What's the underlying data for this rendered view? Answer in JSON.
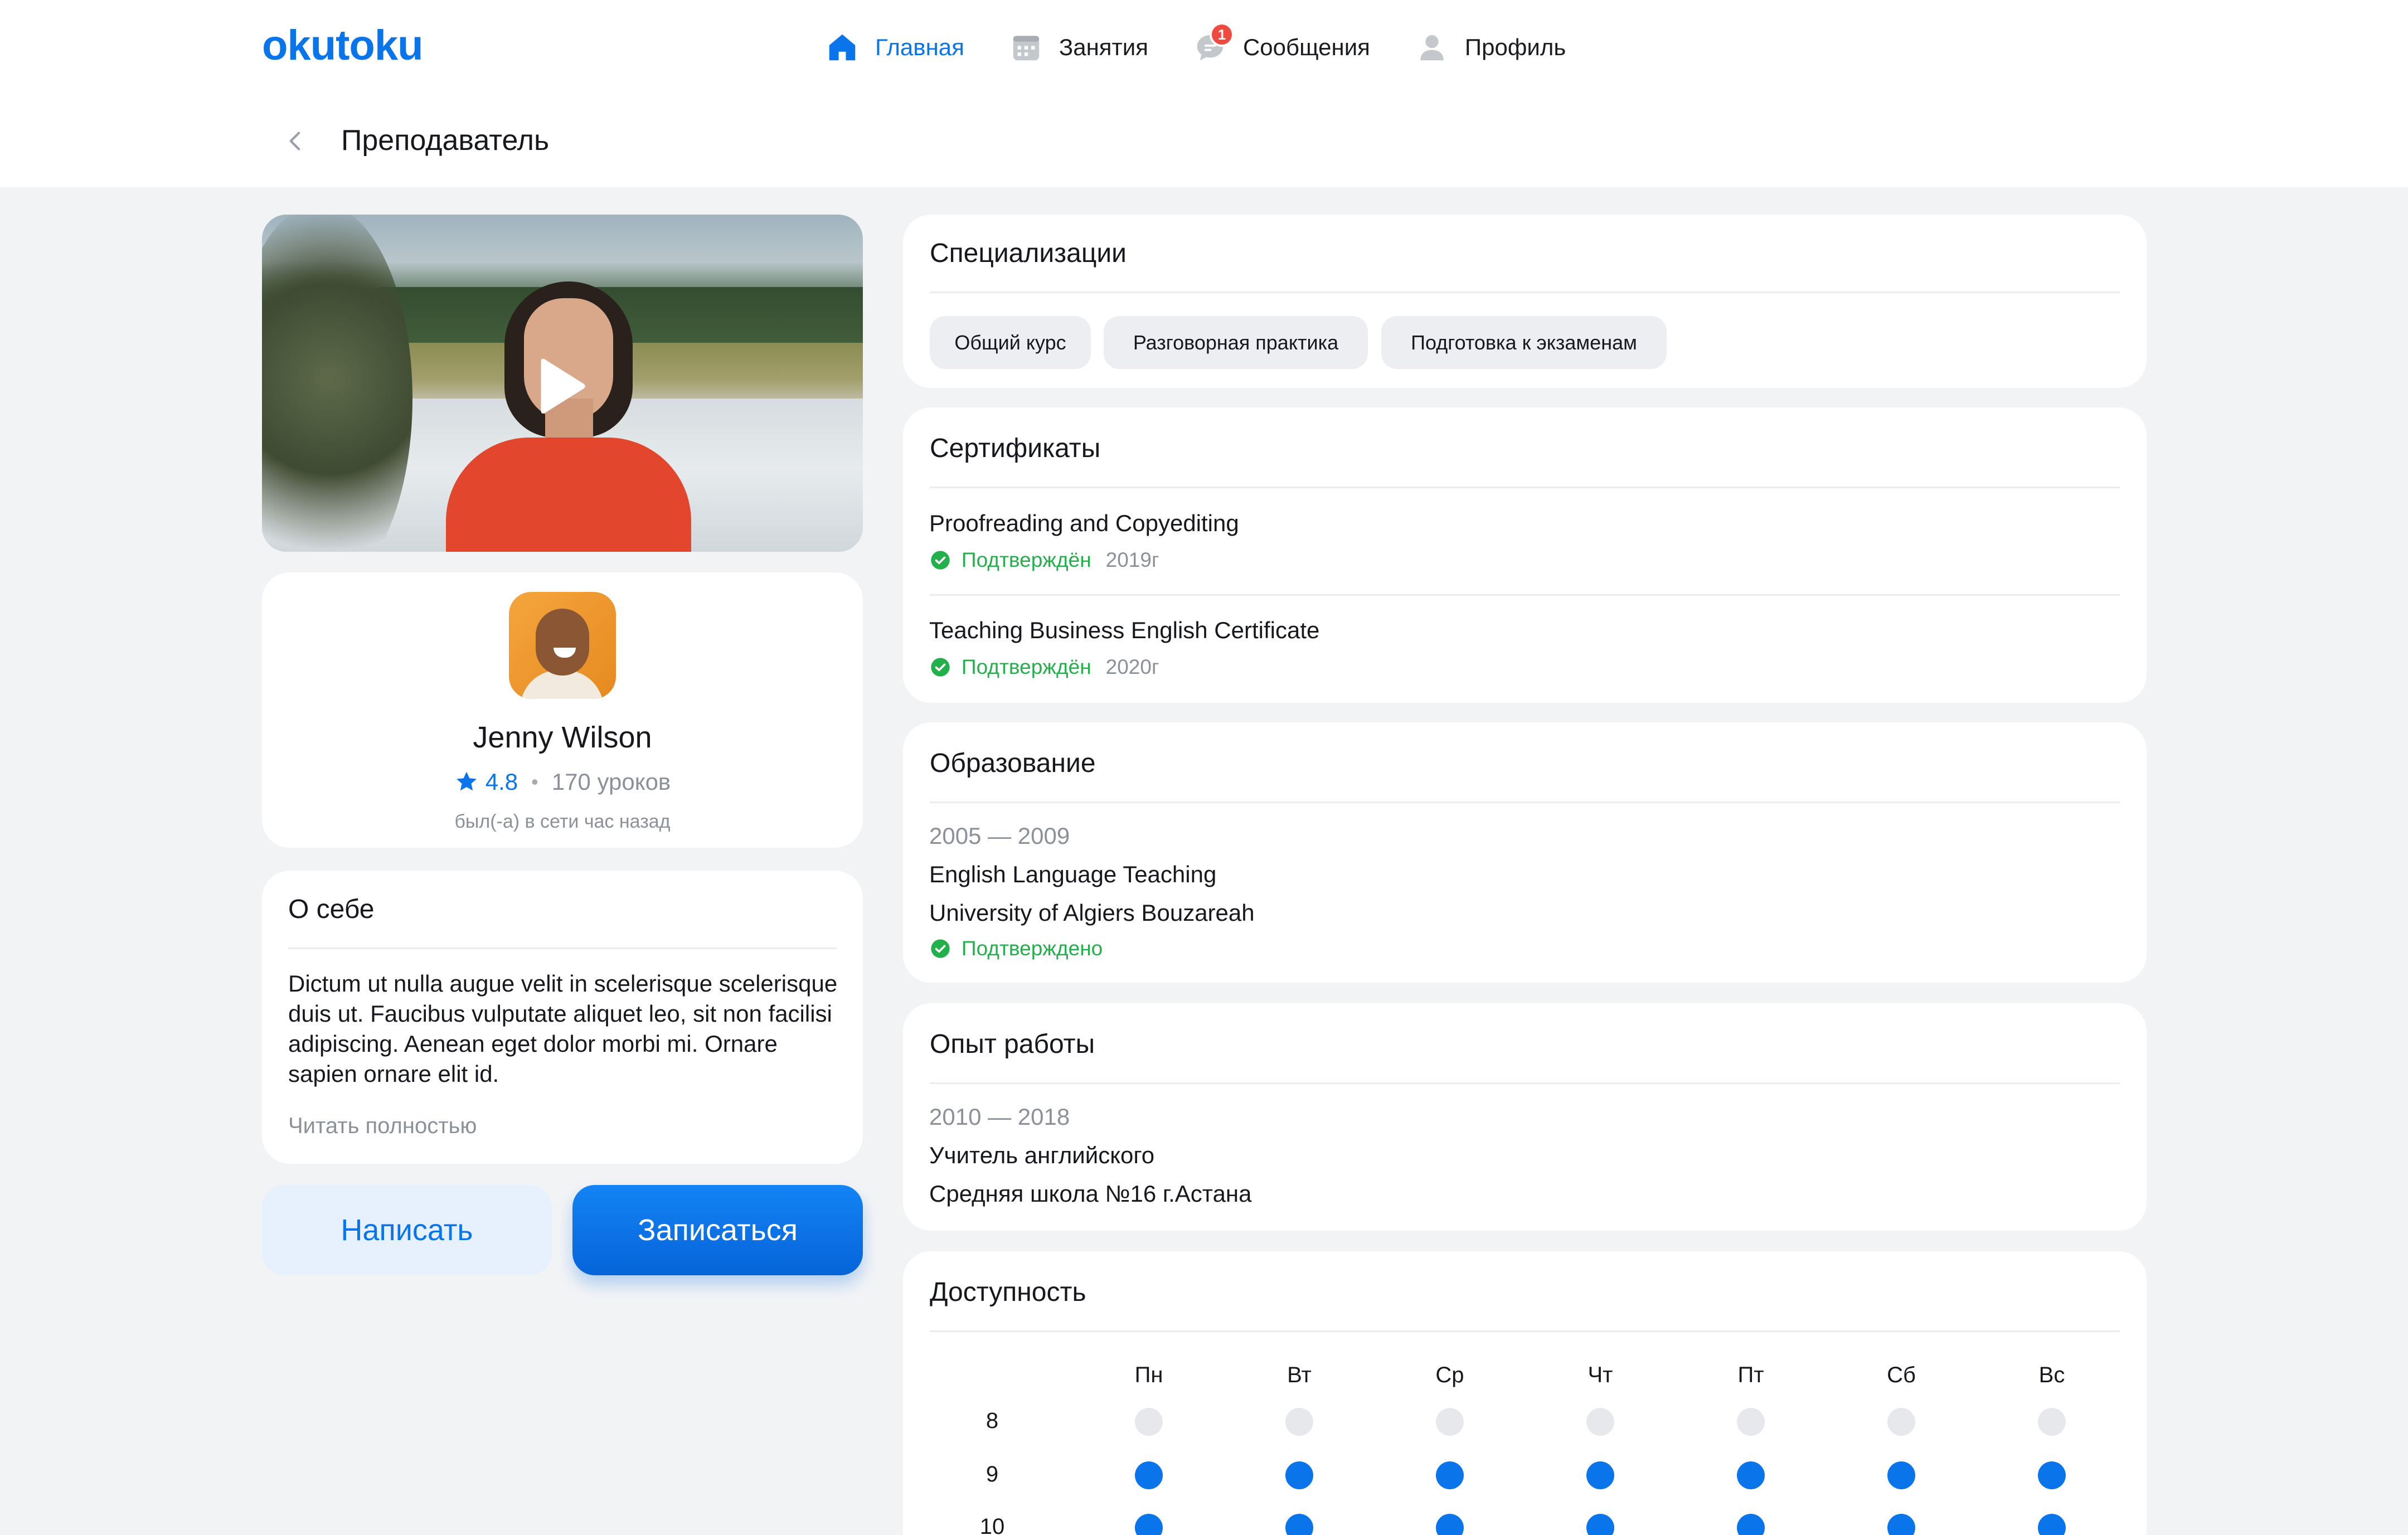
{
  "app": {
    "logo": "okutoku"
  },
  "nav": {
    "home": "Главная",
    "lessons": "Занятия",
    "messages": "Сообщения",
    "messages_badge": "1",
    "profile": "Профиль"
  },
  "page": {
    "title": "Преподаватель"
  },
  "tutor": {
    "name": "Jenny Wilson",
    "rating": "4.8",
    "separator": "•",
    "lessons": "170 уроков",
    "online": "был(-а) в сети час назад"
  },
  "about": {
    "title": "О себе",
    "text": "Dictum ut nulla augue velit in scelerisque scelerisque duis ut. Faucibus vulputate aliquet leo, sit non facilisi adipiscing. Aenean eget dolor morbi mi. Ornare sapien ornare elit id.",
    "read_more": "Читать полностью"
  },
  "actions": {
    "write": "Написать",
    "enroll": "Записаться"
  },
  "specializations": {
    "title": "Специализации",
    "items": [
      "Общий курс",
      "Разговорная практика",
      "Подготовка к экзаменам"
    ]
  },
  "certificates": {
    "title": "Сертификаты",
    "items": [
      {
        "name": "Proofreading and Copyediting",
        "status": "Подтверждён",
        "year": "2019г"
      },
      {
        "name": "Teaching Business English Certificate",
        "status": "Подтверждён",
        "year": "2020г"
      }
    ]
  },
  "education": {
    "title": "Образование",
    "period": "2005 — 2009",
    "program": "English Language Teaching",
    "university": "University of Algiers Bouzareah",
    "status": "Подтверждено"
  },
  "work": {
    "title": "Опыт работы",
    "period": "2010 — 2018",
    "position": "Учитель английского",
    "place": "Средняя школа №16 г.Астана"
  },
  "availability": {
    "title": "Доступность",
    "days": [
      "Пн",
      "Вт",
      "Ср",
      "Чт",
      "Пт",
      "Сб",
      "Вс"
    ],
    "hours": [
      "8",
      "9",
      "10"
    ],
    "slots": [
      [
        false,
        false,
        false,
        false,
        false,
        false,
        false
      ],
      [
        true,
        true,
        true,
        true,
        true,
        true,
        true
      ],
      [
        true,
        true,
        true,
        true,
        true,
        true,
        true
      ]
    ]
  },
  "colors": {
    "accent": "#0a74ea",
    "success": "#22b04b",
    "badge": "#f04a3e",
    "background": "#f2f3f5"
  }
}
